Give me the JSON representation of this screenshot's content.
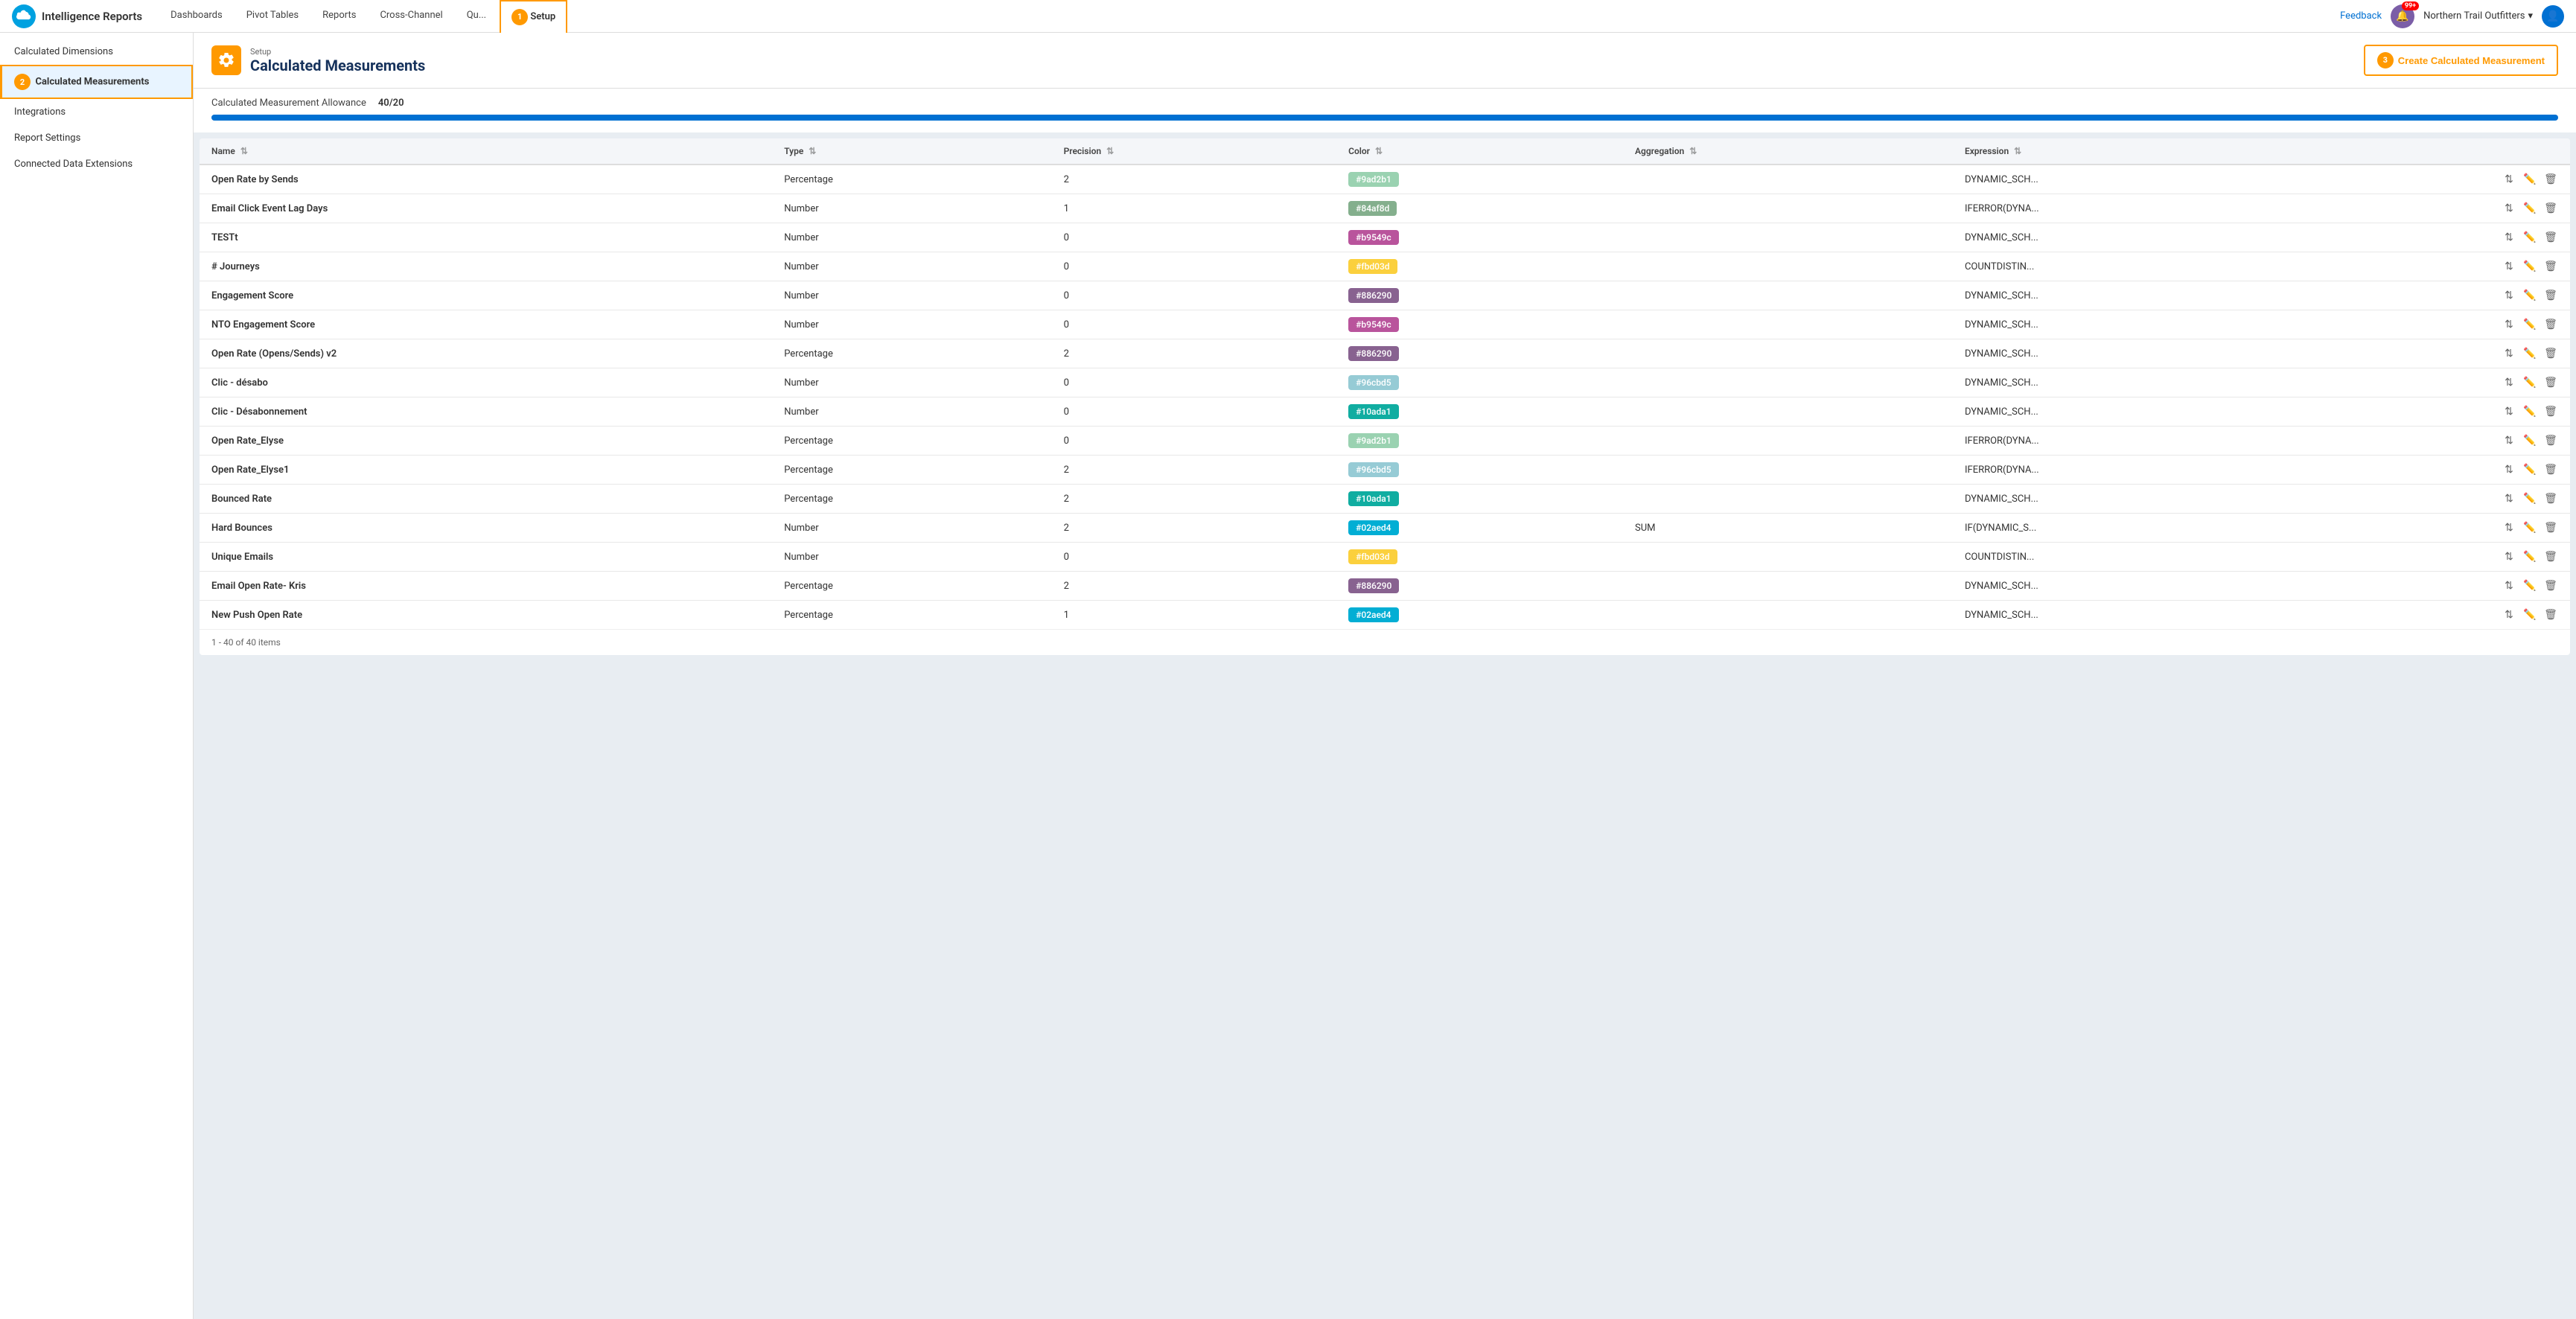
{
  "app": {
    "name": "Intelligence Reports",
    "logo_alt": "Salesforce"
  },
  "nav": {
    "links": [
      {
        "label": "Dashboards",
        "active": false
      },
      {
        "label": "Pivot Tables",
        "active": false
      },
      {
        "label": "Reports",
        "active": false
      },
      {
        "label": "Cross-Channel",
        "active": false
      },
      {
        "label": "Qu...",
        "active": false
      },
      {
        "label": "Setup",
        "active": true
      }
    ],
    "feedback": "Feedback",
    "notifications_count": "99+",
    "org_name": "Northern Trail Outfitters",
    "step1_number": "1"
  },
  "sidebar": {
    "items": [
      {
        "label": "Calculated Dimensions",
        "active": false,
        "id": "calc-dimensions"
      },
      {
        "label": "Calculated Measurements",
        "active": true,
        "id": "calc-measurements"
      },
      {
        "label": "Integrations",
        "active": false,
        "id": "integrations"
      },
      {
        "label": "Report Settings",
        "active": false,
        "id": "report-settings"
      },
      {
        "label": "Connected Data Extensions",
        "active": false,
        "id": "connected-data"
      }
    ],
    "step2_number": "2"
  },
  "page": {
    "setup_label": "Setup",
    "title": "Calculated Measurements",
    "create_button": "Create Calculated Measurement",
    "step3_number": "3",
    "allowance_label": "Calculated Measurement Allowance",
    "allowance_value": "40/20",
    "progress_percent": 100
  },
  "table": {
    "columns": [
      {
        "label": "Name",
        "key": "name"
      },
      {
        "label": "Type",
        "key": "type"
      },
      {
        "label": "Precision",
        "key": "precision"
      },
      {
        "label": "Color",
        "key": "color"
      },
      {
        "label": "Aggregation",
        "key": "aggregation"
      },
      {
        "label": "Expression",
        "key": "expression"
      }
    ],
    "rows": [
      {
        "name": "Open Rate by Sends",
        "type": "Percentage",
        "precision": "2",
        "color": "#9ad2b1",
        "color_label": "#9ad2b1",
        "aggregation": "",
        "expression": "DYNAMIC_SCH..."
      },
      {
        "name": "Email Click Event Lag Days",
        "type": "Number",
        "precision": "1",
        "color": "#84af8d",
        "color_label": "#84af8d",
        "aggregation": "",
        "expression": "IFERROR(DYNA..."
      },
      {
        "name": "TESTt",
        "type": "Number",
        "precision": "0",
        "color": "#b9549c",
        "color_label": "#b9549c",
        "aggregation": "",
        "expression": "DYNAMIC_SCH..."
      },
      {
        "name": "# Journeys",
        "type": "Number",
        "precision": "0",
        "color": "#fbd03d",
        "color_label": "#fbd03d",
        "aggregation": "",
        "expression": "COUNTDISTIN..."
      },
      {
        "name": "Engagement Score",
        "type": "Number",
        "precision": "0",
        "color": "#886290",
        "color_label": "#886290",
        "aggregation": "",
        "expression": "DYNAMIC_SCH..."
      },
      {
        "name": "NTO Engagement Score",
        "type": "Number",
        "precision": "0",
        "color": "#b9549c",
        "color_label": "#b9549c",
        "aggregation": "",
        "expression": "DYNAMIC_SCH..."
      },
      {
        "name": "Open Rate (Opens/Sends) v2",
        "type": "Percentage",
        "precision": "2",
        "color": "#886290",
        "color_label": "#886290",
        "aggregation": "",
        "expression": "DYNAMIC_SCH..."
      },
      {
        "name": "Clic - désabo",
        "type": "Number",
        "precision": "0",
        "color": "#96cbd5",
        "color_label": "#96cbd5",
        "aggregation": "",
        "expression": "DYNAMIC_SCH..."
      },
      {
        "name": "Clic - Désabonnement",
        "type": "Number",
        "precision": "0",
        "color": "#10ada1",
        "color_label": "#10ada1",
        "aggregation": "",
        "expression": "DYNAMIC_SCH..."
      },
      {
        "name": "Open Rate_Elyse",
        "type": "Percentage",
        "precision": "0",
        "color": "#9ad2b1",
        "color_label": "#9ad2b1",
        "aggregation": "",
        "expression": "IFERROR(DYNA..."
      },
      {
        "name": "Open Rate_Elyse1",
        "type": "Percentage",
        "precision": "2",
        "color": "#96cbd5",
        "color_label": "#96cbd5",
        "aggregation": "",
        "expression": "IFERROR(DYNA..."
      },
      {
        "name": "Bounced Rate",
        "type": "Percentage",
        "precision": "2",
        "color": "#10ada1",
        "color_label": "#10ada1",
        "aggregation": "",
        "expression": "DYNAMIC_SCH..."
      },
      {
        "name": "Hard Bounces",
        "type": "Number",
        "precision": "2",
        "color": "#02aed4",
        "color_label": "#02aed4",
        "aggregation": "SUM",
        "expression": "IF(DYNAMIC_S..."
      },
      {
        "name": "Unique Emails",
        "type": "Number",
        "precision": "0",
        "color": "#fbd03d",
        "color_label": "#fbd03d",
        "aggregation": "",
        "expression": "COUNTDISTIN..."
      },
      {
        "name": "Email Open Rate- Kris",
        "type": "Percentage",
        "precision": "2",
        "color": "#886290",
        "color_label": "#886290",
        "aggregation": "",
        "expression": "DYNAMIC_SCH..."
      },
      {
        "name": "New Push Open Rate",
        "type": "Percentage",
        "precision": "1",
        "color": "#02aed4",
        "color_label": "#02aed4",
        "aggregation": "",
        "expression": "DYNAMIC_SCH..."
      }
    ],
    "pagination": "1 - 40 of 40 items"
  }
}
